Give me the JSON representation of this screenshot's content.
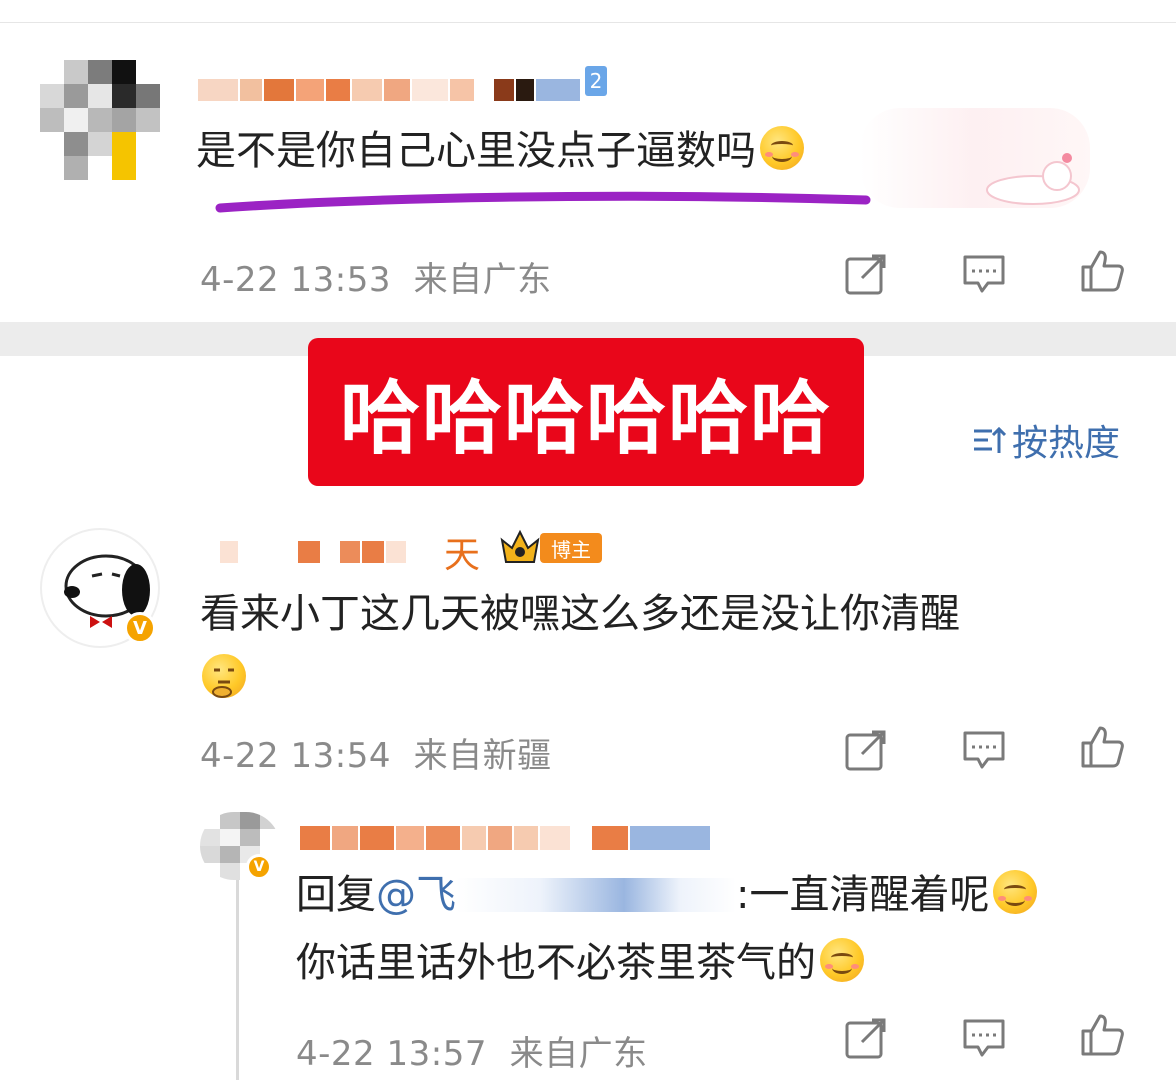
{
  "comments": [
    {
      "text": "是不是你自己心里没点子逼数吗",
      "time": "4-22 13:53",
      "location": "来自广东",
      "user_level": "2"
    },
    {
      "name_tail": "天",
      "badge": "博主",
      "text_line1": "看来小丁这几天被嘿这么多还是没让你清醒",
      "time": "4-22 13:54",
      "location": "来自新疆"
    }
  ],
  "reply": {
    "prefix": "回复",
    "mention": "@飞",
    "text_line1": ":一直清醒着呢",
    "text_line2": "你话里话外也不必茶里茶气的",
    "time": "4-22 13:57",
    "location": "来自广东"
  },
  "banner": {
    "text": "哈哈哈哈哈哈"
  },
  "sort": {
    "label": "按热度",
    "icon": "sort-icon"
  },
  "icons": {
    "share": "share-icon",
    "comment": "comment-icon",
    "like": "thumbs-up-icon",
    "emoji": "smile-emoji-icon"
  },
  "colors": {
    "banner_red": "#e9061a",
    "link_blue": "#3f6fae",
    "meta_gray": "#8a8a8a",
    "underline_purple": "#9b23c4",
    "blogger_orange": "#f38b1c"
  }
}
